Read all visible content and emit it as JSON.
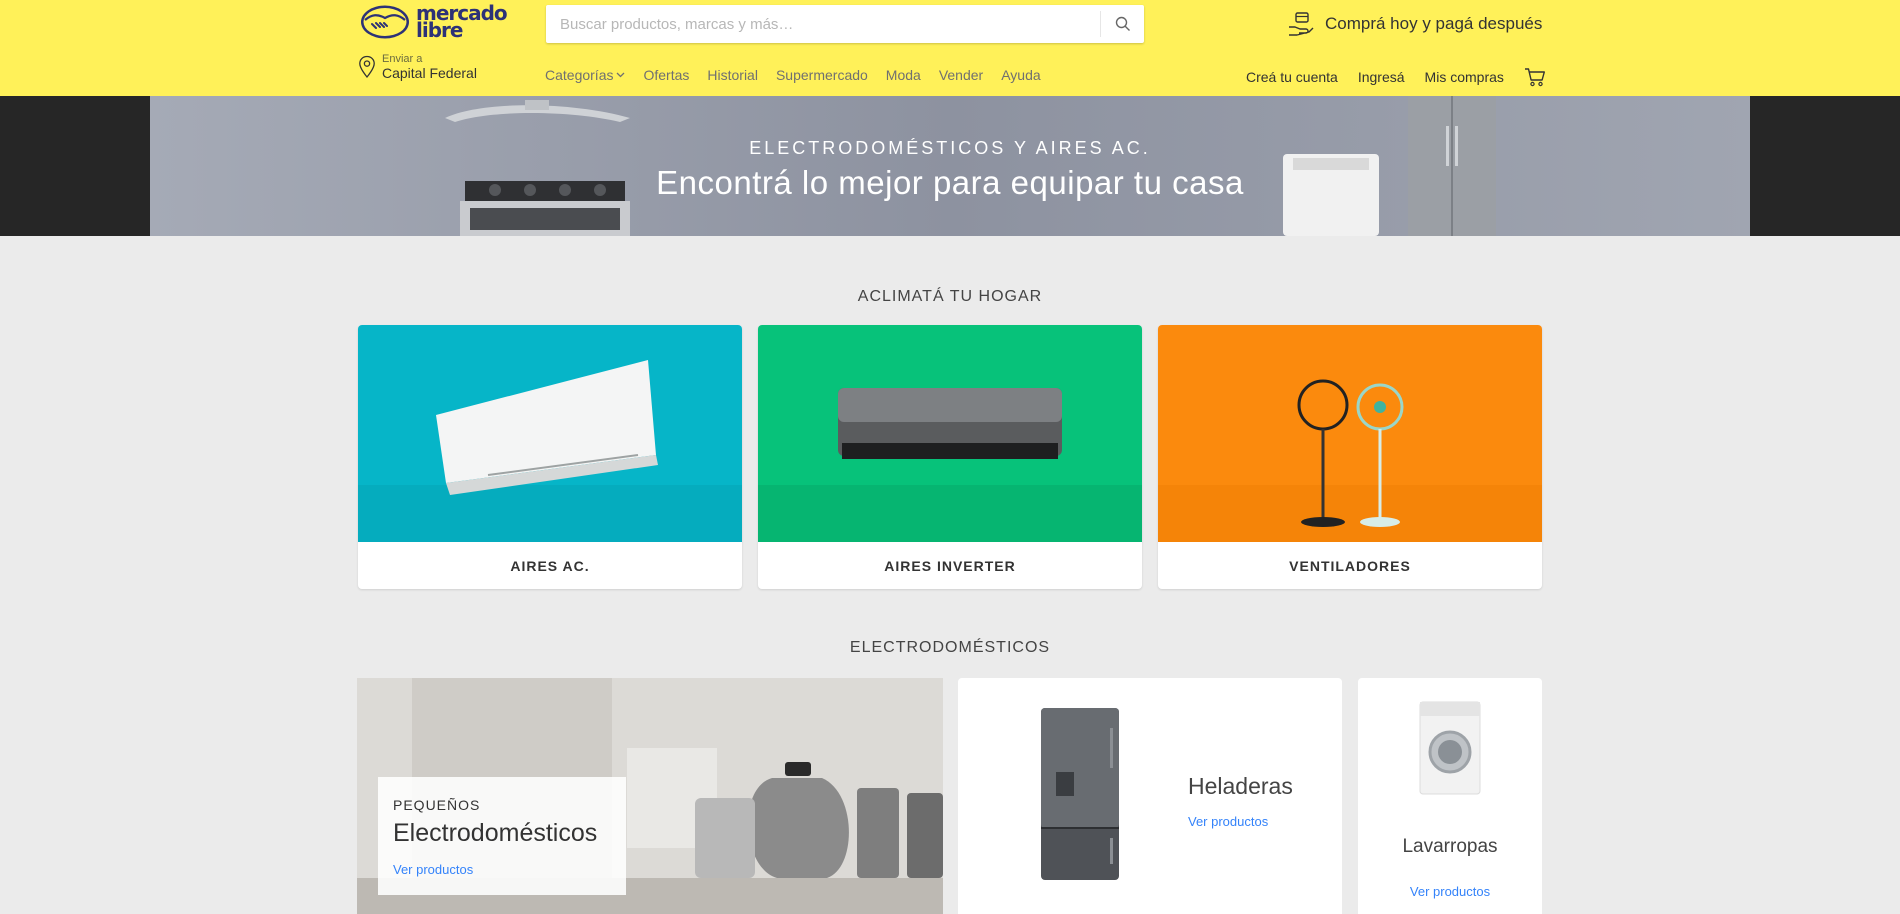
{
  "header": {
    "logo_text_line1": "mercado",
    "logo_text_line2": "libre",
    "search_placeholder": "Buscar productos, marcas y más…",
    "promo_text": "Comprá hoy y pagá después",
    "location_label": "Enviar a",
    "location_value": "Capital Federal",
    "nav": [
      "Categorías",
      "Ofertas",
      "Historial",
      "Supermercado",
      "Moda",
      "Vender",
      "Ayuda"
    ],
    "user_nav": [
      "Creá tu cuenta",
      "Ingresá",
      "Mis compras"
    ],
    "colors": {
      "background": "#fff159",
      "brand_blue": "#2d3277"
    }
  },
  "banner": {
    "subtitle": "ELECTRODOMÉSTICOS Y AIRES AC.",
    "title": "Encontrá lo mejor para equipar tu casa"
  },
  "climate_section": {
    "title": "ACLIMATÁ TU HOGAR",
    "cards": [
      {
        "label": "AIRES AC.",
        "color": "#06b5c8"
      },
      {
        "label": "AIRES INVERTER",
        "color": "#07c27a"
      },
      {
        "label": "VENTILADORES",
        "color": "#fb8a0d"
      }
    ]
  },
  "appliances_section": {
    "title": "ELECTRODOMÉSTICOS",
    "big_card": {
      "pre": "PEQUEÑOS",
      "title": "Electrodomésticos",
      "link": "Ver productos"
    },
    "mid_card": {
      "title": "Heladeras",
      "link": "Ver productos"
    },
    "small_card": {
      "title": "Lavarropas",
      "link": "Ver productos"
    }
  },
  "icons": [
    "search-icon",
    "location-pin-icon",
    "hand-card-icon",
    "chevron-down-icon",
    "cart-icon",
    "mercadolibre-handshake-logo"
  ]
}
